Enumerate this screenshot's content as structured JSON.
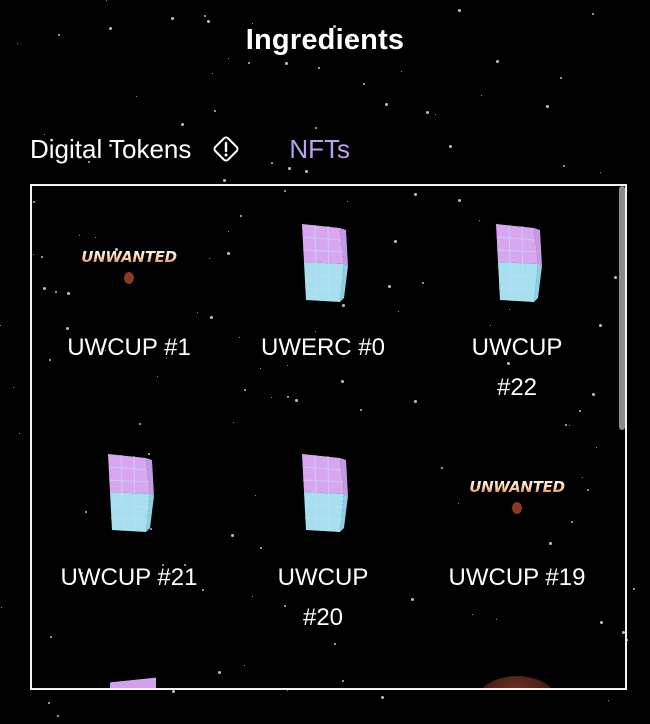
{
  "header": {
    "title": "Ingredients"
  },
  "tabs": [
    {
      "label": "Digital Tokens",
      "active": false,
      "icon": "warning-diamond-icon"
    },
    {
      "label": "NFTs",
      "active": true,
      "accent": "#b7a3f2"
    }
  ],
  "nfts": [
    {
      "name": "UWCUP #1",
      "image": "unwanted-logo"
    },
    {
      "name": "UWERC #0",
      "image": "cube"
    },
    {
      "name": "UWCUP #22",
      "image": "cube"
    },
    {
      "name": "UWCUP #21",
      "image": "cube"
    },
    {
      "name": "UWCUP #20",
      "image": "cube"
    },
    {
      "name": "UWCUP #19",
      "image": "unwanted-logo"
    }
  ],
  "logo": {
    "text": "UNWANTED"
  },
  "colors": {
    "background": "#000000",
    "accent": "#b7a3f2",
    "panel_border": "#f2f2f2"
  }
}
